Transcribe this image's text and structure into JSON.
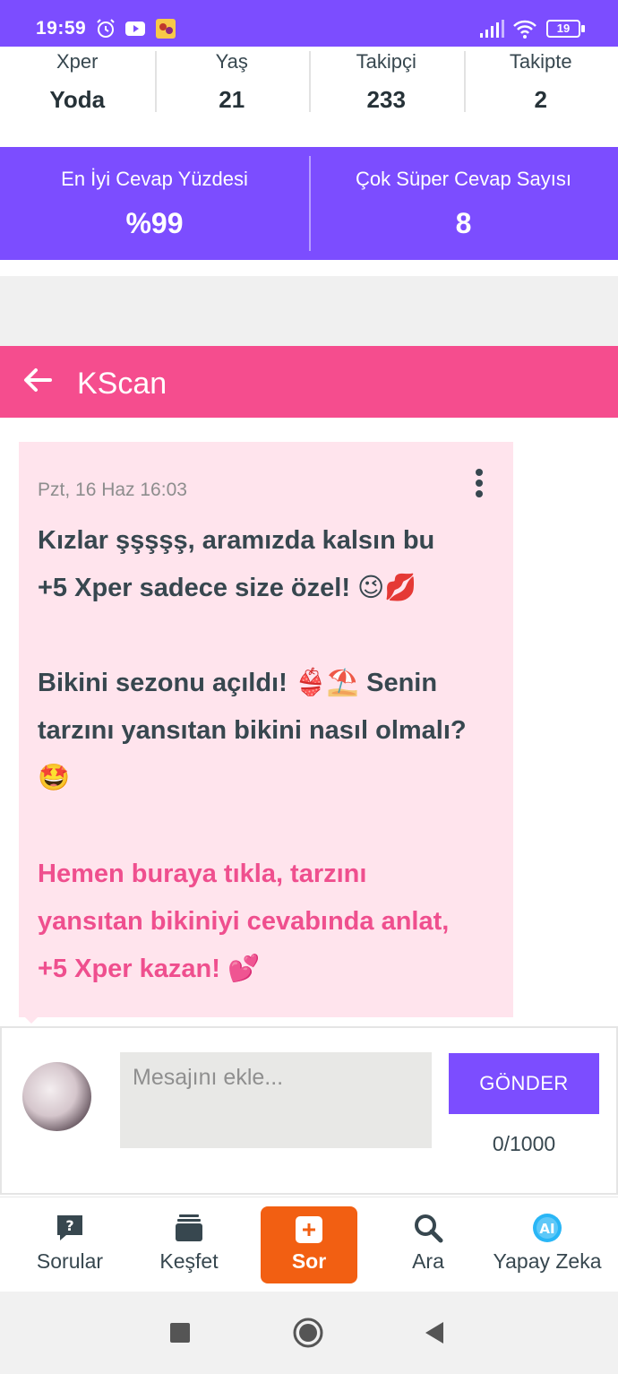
{
  "status_bar": {
    "time": "19:59",
    "battery": "19"
  },
  "profile_stats": [
    {
      "label": "Xper",
      "value": "Yoda"
    },
    {
      "label": "Yaş",
      "value": "21"
    },
    {
      "label": "Takipçi",
      "value": "233"
    },
    {
      "label": "Takipte",
      "value": "2"
    }
  ],
  "answer_stats": [
    {
      "label": "En İyi Cevap Yüzdesi",
      "value": "%99"
    },
    {
      "label": "Çok Süper Cevap Sayısı",
      "value": "8"
    }
  ],
  "chat": {
    "title": "KScan"
  },
  "message": {
    "time": "Pzt, 16 Haz 16:03",
    "text": "Kızlar şşşşş, aramızda kalsın bu\n+5 Xper sadece size özel! 😉💋\n\nBikini sezonu açıldı! 👙⛱️ Senin\ntarzını yansıtan bikini nasıl olmalı?\n🤩",
    "link": "Hemen buraya tıkla, tarzını\nyansıtan bikiniyi cevabında anlat,\n+5 Xper kazan! 💕"
  },
  "composer": {
    "placeholder": "Mesajını ekle...",
    "send_label": "GÖNDER",
    "counter": "0/1000"
  },
  "bottom_nav": [
    {
      "label": "Sorular",
      "icon": "question-bubble-icon"
    },
    {
      "label": "Keşfet",
      "icon": "cards-icon"
    },
    {
      "label": "Sor",
      "icon": "plus-box-icon"
    },
    {
      "label": "Ara",
      "icon": "search-icon"
    },
    {
      "label": "Yapay Zeka",
      "icon": "ai-icon"
    }
  ],
  "colors": {
    "primary": "#7c4dff",
    "chat_header": "#f54d8e",
    "bubble": "#ffe4ed",
    "link": "#ef4f8e",
    "ask_button": "#f25f12"
  }
}
